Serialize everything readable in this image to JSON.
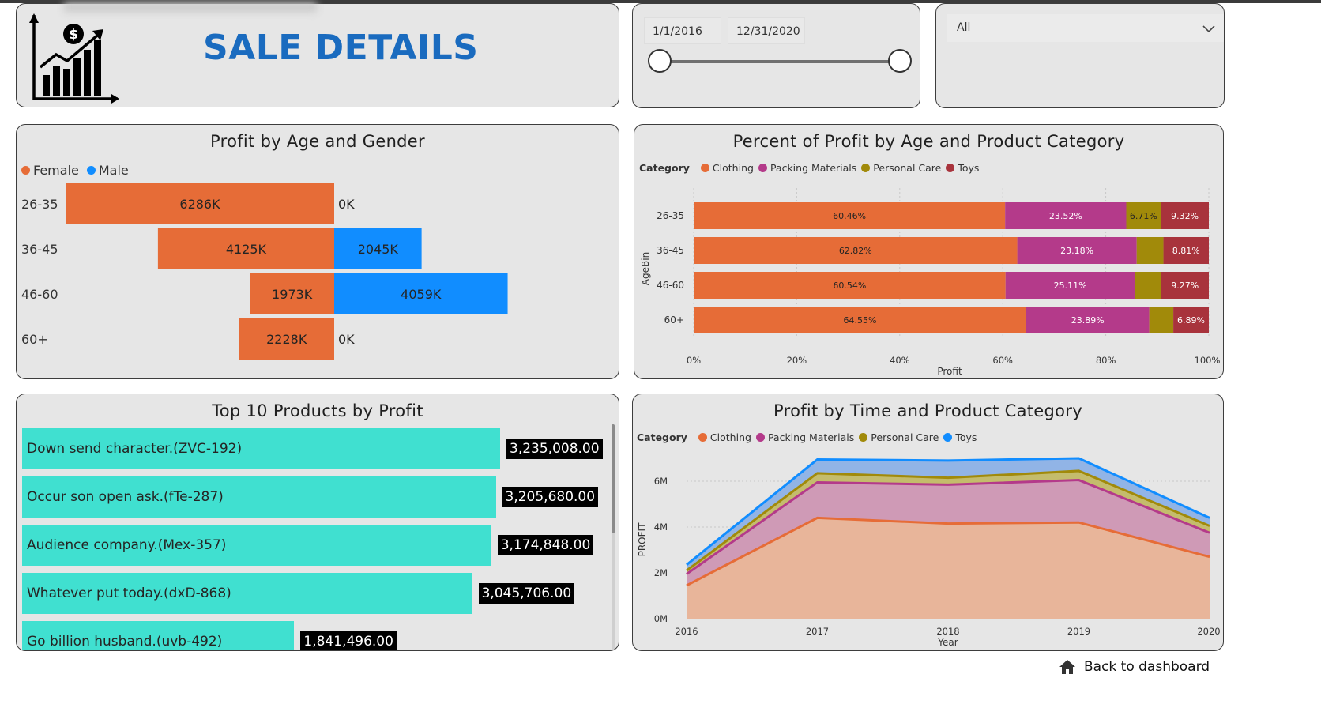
{
  "header": {
    "title": "SALE DETAILS",
    "logo": "profit-chart-logo-icon"
  },
  "date_slicer": {
    "start": "1/1/2016",
    "end": "12/31/2020"
  },
  "dropdown": {
    "value": "All",
    "icon": "chevron-down-icon"
  },
  "colors": {
    "female": "#e66c37",
    "male": "#118dff",
    "clothing": "#e66c37",
    "packing": "#b43a8a",
    "personal": "#a18a0a",
    "toys": "#a8333c",
    "toys_area": "#118dff",
    "turquoise": "#40e0d0"
  },
  "age_gender": {
    "title": "Profit by Age and Gender",
    "legend": [
      "Female",
      "Male"
    ],
    "rows": [
      {
        "age": "26-35",
        "female": 6286,
        "male": 0,
        "female_label": "6286K",
        "male_label": "0K"
      },
      {
        "age": "36-45",
        "female": 4125,
        "male": 2045,
        "female_label": "4125K",
        "male_label": "2045K"
      },
      {
        "age": "46-60",
        "female": 1973,
        "male": 4059,
        "female_label": "1973K",
        "male_label": "4059K"
      },
      {
        "age": "60+",
        "female": 2228,
        "male": 0,
        "female_label": "2228K",
        "male_label": "0K"
      }
    ]
  },
  "percent_chart": {
    "title": "Percent of Profit by Age and Product Category",
    "legend_title": "Category",
    "legend": [
      "Clothing",
      "Packing Materials",
      "Personal Care",
      "Toys"
    ],
    "ylabel": "AgeBin",
    "xlabel": "Profit",
    "xticks": [
      "0%",
      "20%",
      "40%",
      "60%",
      "80%",
      "100%"
    ],
    "rows": [
      {
        "age": "26-35",
        "values": [
          60.46,
          23.52,
          6.71,
          9.32
        ],
        "labels": [
          "60.46%",
          "23.52%",
          "6.71%",
          "9.32%"
        ]
      },
      {
        "age": "36-45",
        "values": [
          62.82,
          23.18,
          5.19,
          8.81
        ],
        "labels": [
          "62.82%",
          "23.18%",
          "",
          "8.81%"
        ]
      },
      {
        "age": "46-60",
        "values": [
          60.54,
          25.11,
          5.08,
          9.27
        ],
        "labels": [
          "60.54%",
          "25.11%",
          "",
          "9.27%"
        ]
      },
      {
        "age": "60+",
        "values": [
          64.55,
          23.89,
          4.67,
          6.89
        ],
        "labels": [
          "64.55%",
          "23.89%",
          "",
          "6.89%"
        ]
      }
    ]
  },
  "top_products": {
    "title": "Top 10 Products by Profit",
    "items": [
      {
        "name": "Down send character.(ZVC-192)",
        "value": 3235008,
        "label": "3,235,008.00"
      },
      {
        "name": "Occur son open ask.(fTe-287)",
        "value": 3205680,
        "label": "3,205,680.00"
      },
      {
        "name": "Audience company.(Mex-357)",
        "value": 3174848,
        "label": "3,174,848.00"
      },
      {
        "name": "Whatever put today.(dxD-868)",
        "value": 3045706,
        "label": "3,045,706.00"
      },
      {
        "name": "Go billion husband.(uvb-492)",
        "value": 1841496,
        "label": "1,841,496.00"
      }
    ]
  },
  "chart_data": {
    "type": "area",
    "title": "Profit by Time and Product Category",
    "legend_title": "Category",
    "xlabel": "Year",
    "ylabel": "PROFIT",
    "x": [
      "2016",
      "2017",
      "2018",
      "2019",
      "2020"
    ],
    "yticks": [
      "0M",
      "2M",
      "4M",
      "6M"
    ],
    "ylim": [
      0,
      7
    ],
    "series": [
      {
        "name": "Clothing",
        "values": [
          1.45,
          4.4,
          4.15,
          4.2,
          2.7
        ]
      },
      {
        "name": "Packing Materials",
        "values": [
          0.5,
          1.55,
          1.7,
          1.85,
          1.05
        ]
      },
      {
        "name": "Personal Care",
        "values": [
          0.15,
          0.4,
          0.3,
          0.4,
          0.3
        ]
      },
      {
        "name": "Toys",
        "values": [
          0.25,
          0.6,
          0.75,
          0.55,
          0.35
        ]
      }
    ]
  },
  "footer": {
    "back_label": "Back to dashboard",
    "icon": "home-icon"
  }
}
